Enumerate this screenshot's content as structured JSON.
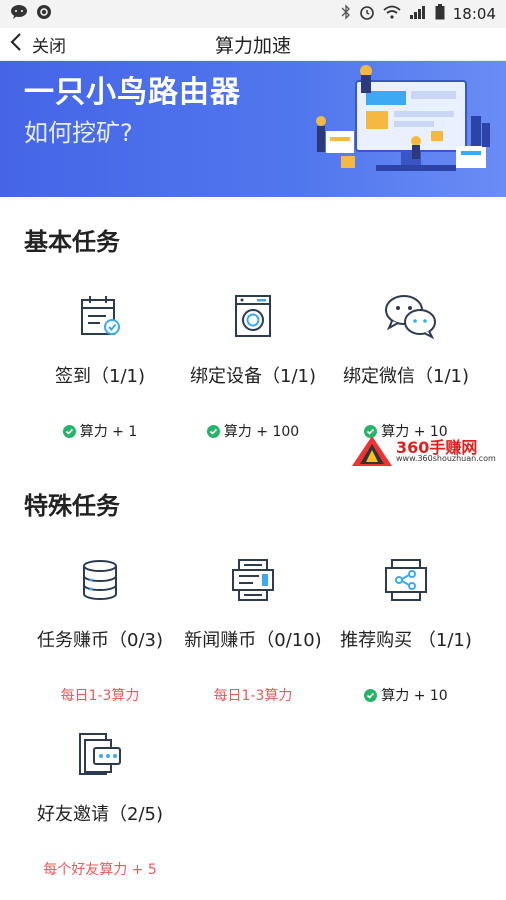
{
  "status_bar": {
    "time": "18:04"
  },
  "nav": {
    "back_label": "关闭",
    "title": "算力加速"
  },
  "banner": {
    "title": "一只小鸟路由器",
    "subtitle": "如何挖矿?"
  },
  "basic_tasks": {
    "title": "基本任务",
    "items": [
      {
        "name": "签到（1/1)",
        "reward": "算力 + 1",
        "icon": "calendar-check-icon"
      },
      {
        "name": "绑定设备（1/1)",
        "reward": "算力 + 100",
        "icon": "washing-machine-icon"
      },
      {
        "name": "绑定微信（1/1)",
        "reward": "算力 + 10",
        "icon": "wechat-icon"
      }
    ]
  },
  "special_tasks": {
    "title": "特殊任务",
    "items": [
      {
        "name": "任务赚币（0/3)",
        "reward": "每日1-3算力",
        "icon": "database-icon"
      },
      {
        "name": "新闻赚币（0/10)",
        "reward": "每日1-3算力",
        "icon": "news-icon"
      },
      {
        "name": "推荐购买 （1/1)",
        "reward": "算力 + 10",
        "icon": "share-icon"
      },
      {
        "name": "好友邀请（2/5)",
        "reward": "每个好友算力 + 5",
        "icon": "invite-icon"
      }
    ]
  },
  "watermark": {
    "name": "360手赚网",
    "url": "www.360shouzhuan.com"
  },
  "colors": {
    "banner": "#4f72ea",
    "check": "#27b36a",
    "red_text": "#e85b5b",
    "icon_stroke": "#2e3b4e"
  }
}
